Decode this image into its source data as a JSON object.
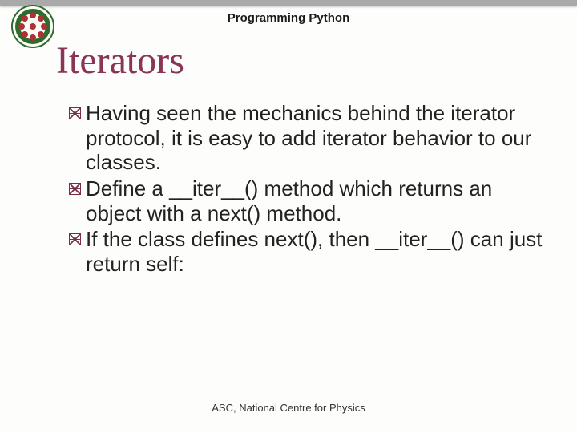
{
  "header": {
    "label": "Programming Python"
  },
  "title": "Iterators",
  "bullets": [
    "Having seen the mechanics behind the iterator protocol, it is easy to add iterator behavior to our classes.",
    "Define a __iter__() method which returns an object with a next() method.",
    "If the class defines next(), then __iter__() can just return self:"
  ],
  "footer": "ASC, National Centre for Physics"
}
